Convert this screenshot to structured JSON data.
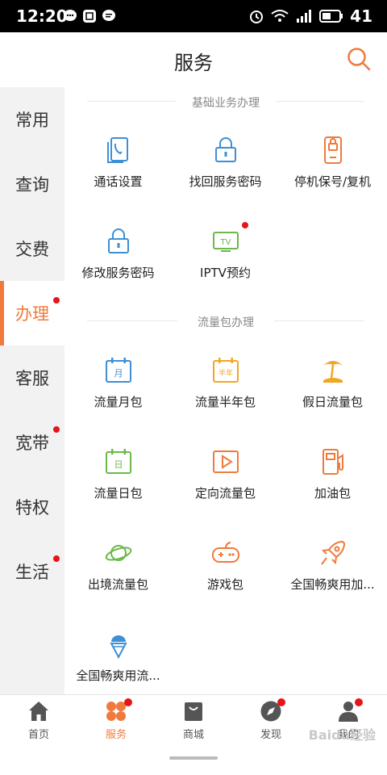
{
  "status_bar": {
    "time": "12:20",
    "battery": "41",
    "net": "4G"
  },
  "header": {
    "title": "服务"
  },
  "sidebar": {
    "items": [
      {
        "label": "常用",
        "dot": false,
        "active": false
      },
      {
        "label": "查询",
        "dot": false,
        "active": false
      },
      {
        "label": "交费",
        "dot": false,
        "active": false
      },
      {
        "label": "办理",
        "dot": true,
        "active": true
      },
      {
        "label": "客服",
        "dot": false,
        "active": false
      },
      {
        "label": "宽带",
        "dot": true,
        "active": false
      },
      {
        "label": "特权",
        "dot": false,
        "active": false
      },
      {
        "label": "生活",
        "dot": true,
        "active": false
      }
    ]
  },
  "sections": [
    {
      "title": "基础业务办理",
      "items": [
        {
          "label": "通话设置",
          "icon": "phone-settings-icon"
        },
        {
          "label": "找回服务密码",
          "icon": "lock-icon"
        },
        {
          "label": "停机保号/复机",
          "icon": "sim-card-icon"
        },
        {
          "label": "修改服务密码",
          "icon": "lock-icon"
        },
        {
          "label": "IPTV预约",
          "icon": "tv-icon",
          "dot": true
        }
      ]
    },
    {
      "title": "流量包办理",
      "items": [
        {
          "label": "流量月包",
          "icon": "calendar-month-icon",
          "icon_text": "月"
        },
        {
          "label": "流量半年包",
          "icon": "calendar-halfyear-icon",
          "icon_text": "半年"
        },
        {
          "label": "假日流量包",
          "icon": "beach-icon"
        },
        {
          "label": "流量日包",
          "icon": "calendar-day-icon",
          "icon_text": "日"
        },
        {
          "label": "定向流量包",
          "icon": "play-icon"
        },
        {
          "label": "加油包",
          "icon": "fuel-icon"
        },
        {
          "label": "出境流量包",
          "icon": "planet-icon"
        },
        {
          "label": "游戏包",
          "icon": "gamepad-icon"
        },
        {
          "label": "全国畅爽用加...",
          "icon": "rocket-icon"
        },
        {
          "label": "全国畅爽用流...",
          "icon": "ice-cream-icon"
        }
      ]
    }
  ],
  "tabbar": {
    "items": [
      {
        "label": "首页",
        "icon": "home-icon",
        "active": false,
        "dot": false
      },
      {
        "label": "服务",
        "icon": "service-icon",
        "active": true,
        "dot": true
      },
      {
        "label": "商城",
        "icon": "shopping-bag-icon",
        "active": false,
        "dot": false
      },
      {
        "label": "发现",
        "icon": "compass-icon",
        "active": false,
        "dot": true
      },
      {
        "label": "我的",
        "icon": "user-icon",
        "active": false,
        "dot": true
      }
    ]
  },
  "watermark": "Baidu经验",
  "colors": {
    "accent": "#f07a3c",
    "blue": "#3d8fd6",
    "green": "#6cb84a",
    "yellow": "#f2a623",
    "red_dot": "#e8141b"
  }
}
